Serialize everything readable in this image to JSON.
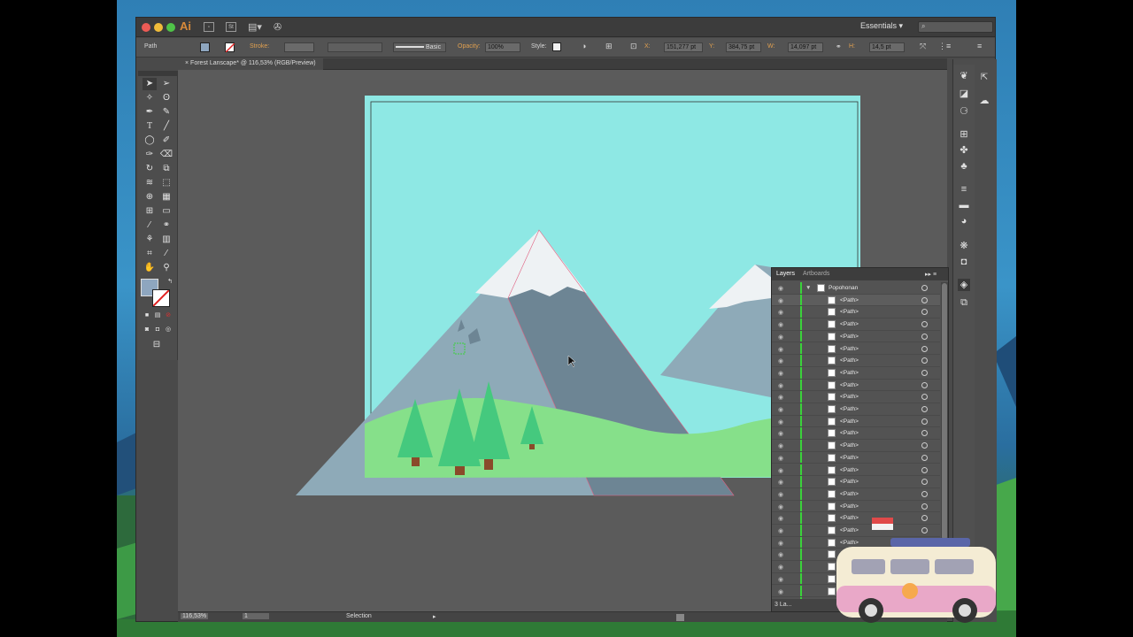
{
  "window": {
    "app_logo": "Ai",
    "workspace_label": "Essentials",
    "workspace_arrow": "▾",
    "search_icon": "⌕",
    "arrange_label": "▤▾",
    "doc_label": "St"
  },
  "control_bar": {
    "selection_kind": "Path",
    "stroke_label": "Stroke:",
    "brush_label": "Basic",
    "opacity_label": "Opacity:",
    "opacity_value": "100%",
    "style_label": "Style:",
    "x_label": "X:",
    "x_value": "151,277 pt",
    "y_label": "Y:",
    "y_value": "384,75 pt",
    "w_label": "W:",
    "w_value": "14,097 pt",
    "h_label": "H:",
    "h_value": "14,5 pt"
  },
  "document_tab": {
    "close_glyph": "×",
    "title": "Forest Lanscape* @ 116,53% (RGB/Preview)"
  },
  "status_bar": {
    "zoom": "116,53%",
    "artboard_number": "1",
    "tool_name": "Selection"
  },
  "layers_panel": {
    "tab_layers": "Layers",
    "tab_artboards": "Artboards",
    "menu_glyph": "▸▸ ≡",
    "top_layer_name": "Popohonan",
    "disclosure_glyph": "▼",
    "eye_glyph": "◉",
    "paths": [
      "<Path>",
      "<Path>",
      "<Path>",
      "<Path>",
      "<Path>",
      "<Path>",
      "<Path>",
      "<Path>",
      "<Path>",
      "<Path>",
      "<Path>",
      "<Path>",
      "<Path>",
      "<Path>",
      "<Path>",
      "<Path>",
      "<Path>",
      "<Path>",
      "<Path>",
      "<Path>",
      "<Path>",
      "<Path>",
      "<Path>",
      "<Path>",
      "<Path>",
      "<Path>"
    ],
    "footer_count": "3 La..."
  },
  "colors": {
    "sky": "#8ee8e4",
    "mountain": "#8eaab8",
    "mountain_shade": "#6d8594",
    "snow": "#eef2f4",
    "grass": "#86e08a",
    "tree": "#45c97e",
    "trunk": "#8a4a2a",
    "window_bg": "#4a4a4a",
    "canvas_bg": "#5b5b5b",
    "layer_color": "#3ad23a"
  },
  "icons": {
    "tools": [
      "selection-tool-icon",
      "direct-selection-tool-icon",
      "magic-wand-tool-icon",
      "lasso-tool-icon",
      "pen-tool-icon",
      "curvature-tool-icon",
      "type-tool-icon",
      "line-tool-icon",
      "ellipse-tool-icon",
      "paintbrush-tool-icon",
      "shaper-tool-icon",
      "eraser-tool-icon",
      "rotate-tool-icon",
      "scale-tool-icon",
      "width-tool-icon",
      "free-transform-tool-icon",
      "shape-builder-tool-icon",
      "perspective-grid-tool-icon",
      "mesh-tool-icon",
      "gradient-tool-icon",
      "eyedropper-tool-icon",
      "blend-tool-icon",
      "symbol-sprayer-tool-icon",
      "column-graph-tool-icon",
      "artboard-tool-icon",
      "slice-tool-icon",
      "hand-tool-icon",
      "zoom-tool-icon"
    ]
  }
}
